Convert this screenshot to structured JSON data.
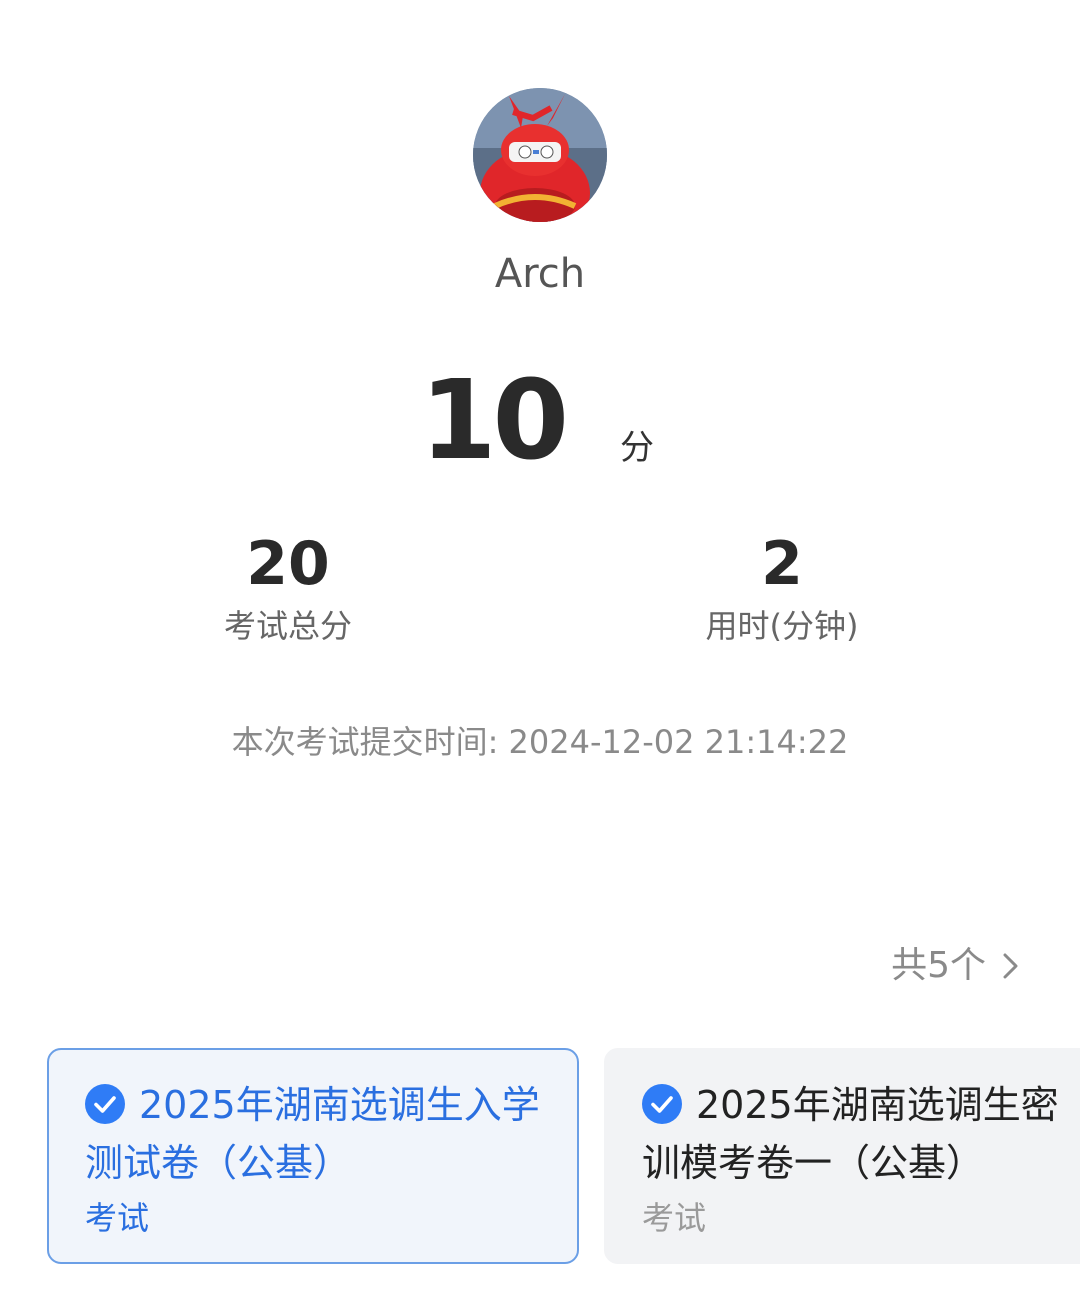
{
  "user": {
    "name": "Arch",
    "avatar": "avatar-image"
  },
  "result": {
    "score": "10",
    "score_unit": "分"
  },
  "stats": {
    "total_score_value": "20",
    "total_score_label": "考试总分",
    "duration_value": "2",
    "duration_label": "用时(分钟)"
  },
  "submit": {
    "text": "本次考试提交时间:  2024-12-02 21:14:22"
  },
  "exams": {
    "count_label": "共5个",
    "items": [
      {
        "title": "2025年湖南选调生入学测试卷（公基）",
        "type": "考试",
        "selected": true
      },
      {
        "title": "2025年湖南选调生密训模考卷一（公基）",
        "type": "考试",
        "selected": false
      }
    ]
  },
  "colors": {
    "accent": "#2a6fe0",
    "check_fill": "#2f7cf6",
    "muted_text": "#8a8a8a",
    "card_selected_bg": "#f1f5fb",
    "card_selected_border": "#6b9fe6",
    "card_bg": "#f2f3f5"
  },
  "icons": {
    "check": "check-circle-icon",
    "chevron": "chevron-right-icon"
  }
}
